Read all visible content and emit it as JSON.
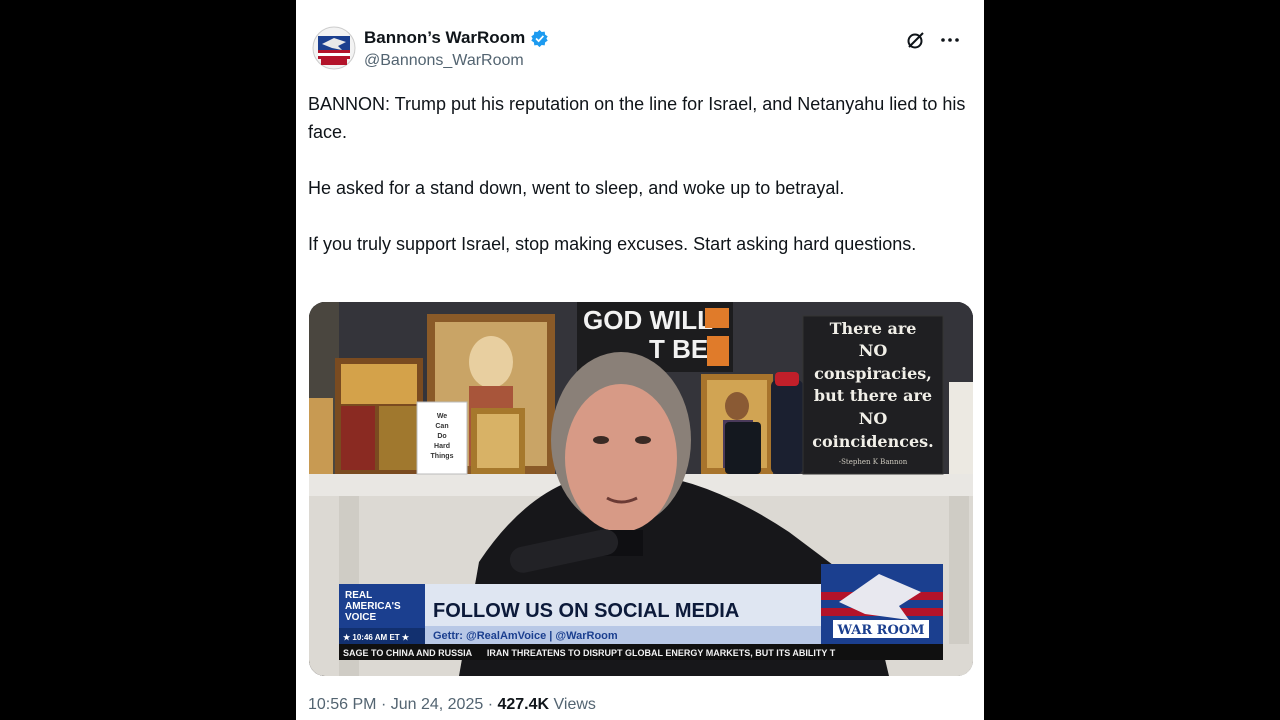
{
  "author": {
    "display_name": "Bannon’s WarRoom",
    "handle": "@Bannons_WarRoom",
    "avatar_icon": "warroom-eagle-logo",
    "verified_icon": "verified-badge-icon"
  },
  "tweet": {
    "paragraphs": [
      "BANNON: Trump put his reputation on the line for Israel, and Netanyahu lied to his face.",
      "He asked for a stand down, went to sleep, and woke up to betrayal.",
      "If you truly support Israel, stop making excuses. Start asking hard questions."
    ]
  },
  "media": {
    "sign_top": "GOD WILL",
    "sign_top2": "T BE",
    "small_sign": [
      "We",
      "Can",
      "Do",
      "Hard",
      "Things"
    ],
    "quote_sign": [
      "There are",
      "NO",
      "conspiracies,",
      "but there are",
      "NO",
      "coincidences."
    ],
    "quote_attribution": "-Stephen K Bannon",
    "lower_third": {
      "network_logo": [
        "REAL",
        "AMERICA'S",
        "VOICE"
      ],
      "time": "★ 10:46 AM ET ★",
      "headline": "FOLLOW US ON SOCIAL MEDIA",
      "subline": "Gettr: @RealAmVoice | @WarRoom",
      "show_logo": "WAR ROOM",
      "ticker": "SAGE TO CHINA AND RUSSIA      IRAN THREATENS TO DISRUPT GLOBAL ENERGY MARKETS, BUT ITS ABILITY T"
    },
    "colors": {
      "banner_blue": "#1b3f8f",
      "banner_red": "#b3132a",
      "sign_orange": "#e07b2a"
    }
  },
  "footer": {
    "time": "10:56 PM",
    "separator": "·",
    "date": "Jun 24, 2025",
    "views_count": "427.4K",
    "views_label": "Views"
  }
}
